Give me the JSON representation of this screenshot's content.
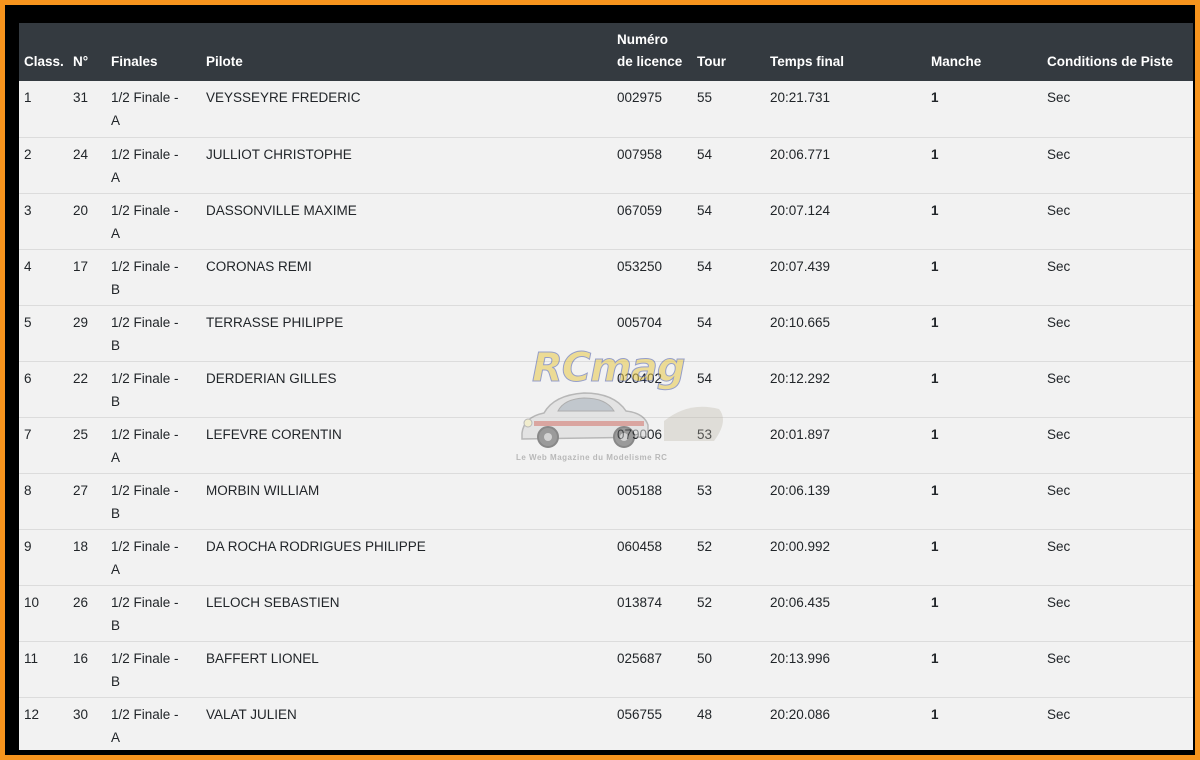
{
  "table": {
    "headers": {
      "rank": "Class.",
      "number": "N°",
      "finale": "Finales",
      "pilot": "Pilote",
      "license_line1": "Numéro",
      "license_line2": "de licence",
      "laps": "Tour",
      "time": "Temps final",
      "heat": "Manche",
      "conditions": "Conditions de Piste"
    },
    "rows": [
      {
        "rank": "1",
        "number": "31",
        "finale_line1": "1/2 Finale -",
        "finale_line2": "A",
        "pilot": "VEYSSEYRE FREDERIC",
        "license": "002975",
        "laps": "55",
        "time": "20:21.731",
        "heat": "1",
        "conditions": "Sec"
      },
      {
        "rank": "2",
        "number": "24",
        "finale_line1": "1/2 Finale -",
        "finale_line2": "A",
        "pilot": "JULLIOT CHRISTOPHE",
        "license": "007958",
        "laps": "54",
        "time": "20:06.771",
        "heat": "1",
        "conditions": "Sec"
      },
      {
        "rank": "3",
        "number": "20",
        "finale_line1": "1/2 Finale -",
        "finale_line2": "A",
        "pilot": "DASSONVILLE MAXIME",
        "license": "067059",
        "laps": "54",
        "time": "20:07.124",
        "heat": "1",
        "conditions": "Sec"
      },
      {
        "rank": "4",
        "number": "17",
        "finale_line1": "1/2 Finale -",
        "finale_line2": "B",
        "pilot": "CORONAS REMI",
        "license": "053250",
        "laps": "54",
        "time": "20:07.439",
        "heat": "1",
        "conditions": "Sec"
      },
      {
        "rank": "5",
        "number": "29",
        "finale_line1": "1/2 Finale -",
        "finale_line2": "B",
        "pilot": "TERRASSE PHILIPPE",
        "license": "005704",
        "laps": "54",
        "time": "20:10.665",
        "heat": "1",
        "conditions": "Sec"
      },
      {
        "rank": "6",
        "number": "22",
        "finale_line1": "1/2 Finale -",
        "finale_line2": "B",
        "pilot": "DERDERIAN GILLES",
        "license": "020402",
        "laps": "54",
        "time": "20:12.292",
        "heat": "1",
        "conditions": "Sec"
      },
      {
        "rank": "7",
        "number": "25",
        "finale_line1": "1/2 Finale -",
        "finale_line2": "A",
        "pilot": "LEFEVRE CORENTIN",
        "license": "079006",
        "laps": "53",
        "time": "20:01.897",
        "heat": "1",
        "conditions": "Sec"
      },
      {
        "rank": "8",
        "number": "27",
        "finale_line1": "1/2 Finale -",
        "finale_line2": "B",
        "pilot": "MORBIN WILLIAM",
        "license": "005188",
        "laps": "53",
        "time": "20:06.139",
        "heat": "1",
        "conditions": "Sec"
      },
      {
        "rank": "9",
        "number": "18",
        "finale_line1": "1/2 Finale -",
        "finale_line2": "A",
        "pilot": "DA ROCHA RODRIGUES PHILIPPE",
        "license": "060458",
        "laps": "52",
        "time": "20:00.992",
        "heat": "1",
        "conditions": "Sec"
      },
      {
        "rank": "10",
        "number": "26",
        "finale_line1": "1/2 Finale -",
        "finale_line2": "B",
        "pilot": "LELOCH SEBASTIEN",
        "license": "013874",
        "laps": "52",
        "time": "20:06.435",
        "heat": "1",
        "conditions": "Sec"
      },
      {
        "rank": "11",
        "number": "16",
        "finale_line1": "1/2 Finale -",
        "finale_line2": "B",
        "pilot": "BAFFERT LIONEL",
        "license": "025687",
        "laps": "50",
        "time": "20:13.996",
        "heat": "1",
        "conditions": "Sec"
      },
      {
        "rank": "12",
        "number": "30",
        "finale_line1": "1/2 Finale -",
        "finale_line2": "A",
        "pilot": "VALAT JULIEN",
        "license": "056755",
        "laps": "48",
        "time": "20:20.086",
        "heat": "1",
        "conditions": "Sec"
      }
    ]
  },
  "watermark": {
    "logo_text": "RCmag",
    "tagline": "Le Web Magazine du Modelisme RC"
  },
  "colors": {
    "border_outer": "#f7941d",
    "border_inner": "#000000",
    "header_bg": "#343a40",
    "row_bg": "#f2f2f2"
  }
}
